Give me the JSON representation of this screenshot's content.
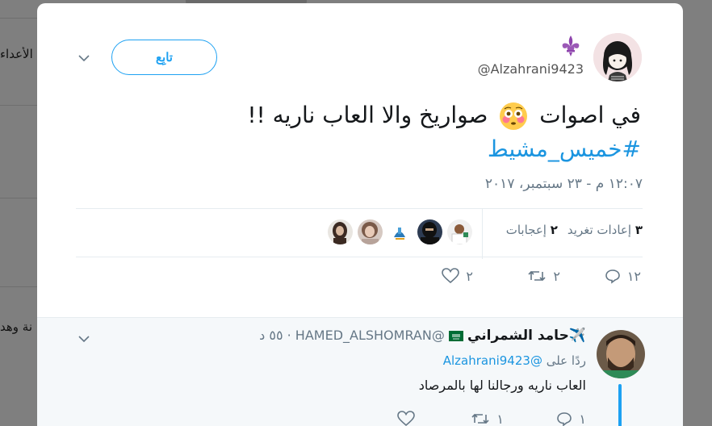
{
  "background": {
    "strip_1": "الأعداء",
    "strip_2": "نة وهد"
  },
  "tweet": {
    "user_handle": "@Alzahrani9423",
    "follow_label": "تابِع",
    "text_line_1_a": "في اصوات",
    "text_line_1_b": "صواريخ والا العاب ناريه !!",
    "hashtag": "#خميس_مشيط",
    "timestamp": "١٢:٠٧ م - ٢٣ سبتمبر، ٢٠١٧",
    "retweets_count": "٣",
    "retweets_label": "إعادات تغريد",
    "likes_count": "٢",
    "likes_label": "إعجابات",
    "actions": {
      "reply_count": "١٢",
      "retweet_count": "٢",
      "like_count": "٢"
    }
  },
  "reply": {
    "display_name": "✈️حامد الشمراني",
    "handle": "@HAMED_ALSHOMRAN",
    "time": "· ٥٥ د",
    "replying_to_label": "ردًا على",
    "replying_to_handle": "@Alzahrani9423",
    "text": "العاب ناريه ورجالنا لها بالمرصاد",
    "actions": {
      "reply_count": "١",
      "retweet_count": "١"
    }
  },
  "colors": {
    "accent": "#1da1f2",
    "link": "#1b95e0",
    "muted": "#657786",
    "overlay": "#7f7f7f"
  },
  "icons": [
    "fleur-de-lis-icon",
    "chevron-down-icon",
    "flushed-face-emoji-icon",
    "reply-icon",
    "retweet-icon",
    "heart-icon",
    "saudi-flag-icon"
  ]
}
